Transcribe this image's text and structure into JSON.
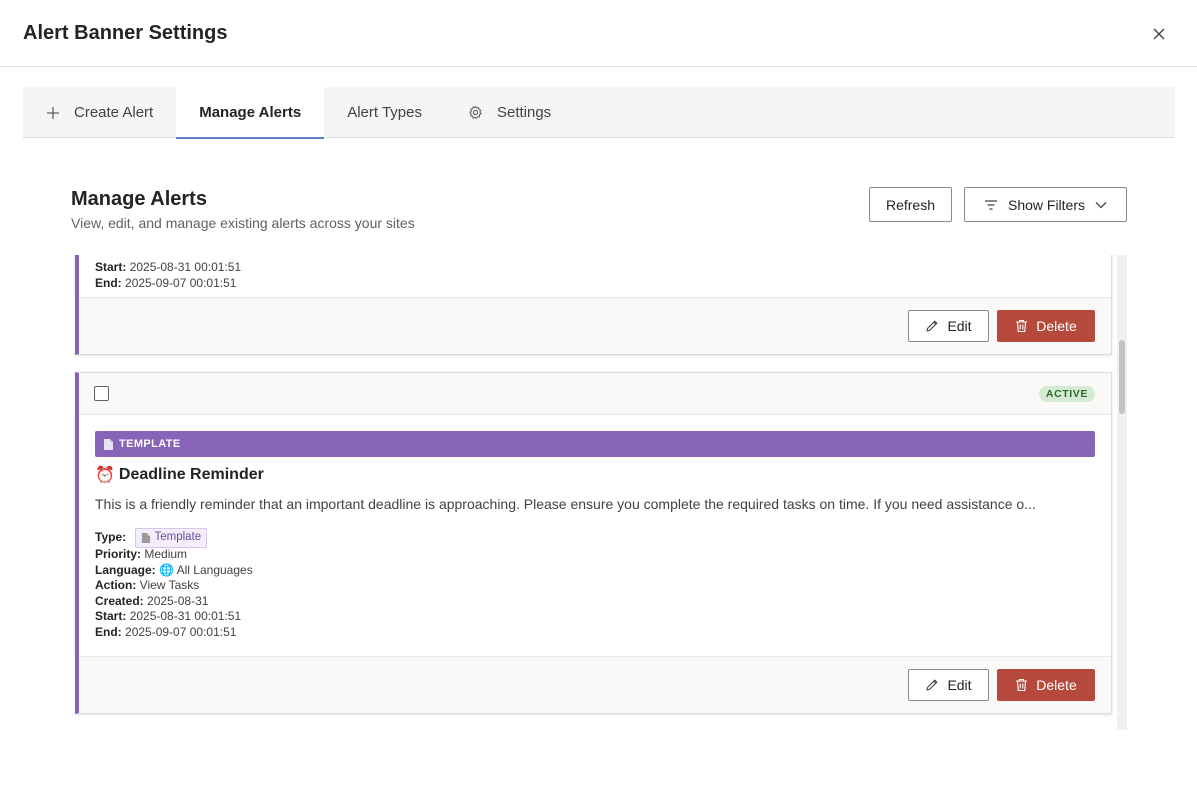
{
  "header": {
    "title": "Alert Banner Settings"
  },
  "tabs": [
    {
      "label": "Create Alert",
      "icon": "plus-icon"
    },
    {
      "label": "Manage Alerts",
      "active": true
    },
    {
      "label": "Alert Types"
    },
    {
      "label": "Settings",
      "icon": "gear-icon"
    }
  ],
  "section": {
    "title": "Manage Alerts",
    "subtitle": "View, edit, and manage existing alerts across your sites",
    "refresh_label": "Refresh",
    "filters_label": "Show Filters"
  },
  "cards": [
    {
      "start_label": "Start:",
      "start": "2025-08-31 00:01:51",
      "end_label": "End:",
      "end": "2025-09-07 00:01:51",
      "edit_label": "Edit",
      "delete_label": "Delete"
    },
    {
      "status": "ACTIVE",
      "template_banner": "TEMPLATE",
      "emoji": "⏰",
      "title": "Deadline Reminder",
      "description": "This is a friendly reminder that an important deadline is approaching. Please ensure you complete the required tasks on time. If you need assistance o...",
      "type_label": "Type:",
      "type_value": "Template",
      "priority_label": "Priority:",
      "priority": "Medium",
      "language_label": "Language:",
      "language_icon": "🌐",
      "language": "All Languages",
      "action_label": "Action:",
      "action": "View Tasks",
      "created_label": "Created:",
      "created": "2025-08-31",
      "start_label": "Start:",
      "start": "2025-08-31 00:01:51",
      "end_label": "End:",
      "end": "2025-09-07 00:01:51",
      "edit_label": "Edit",
      "delete_label": "Delete"
    }
  ],
  "colors": {
    "accent": "#8764b8",
    "danger": "#b54a3c",
    "tab_underline": "#5b7fc7",
    "active_badge": "#d5ead2"
  }
}
